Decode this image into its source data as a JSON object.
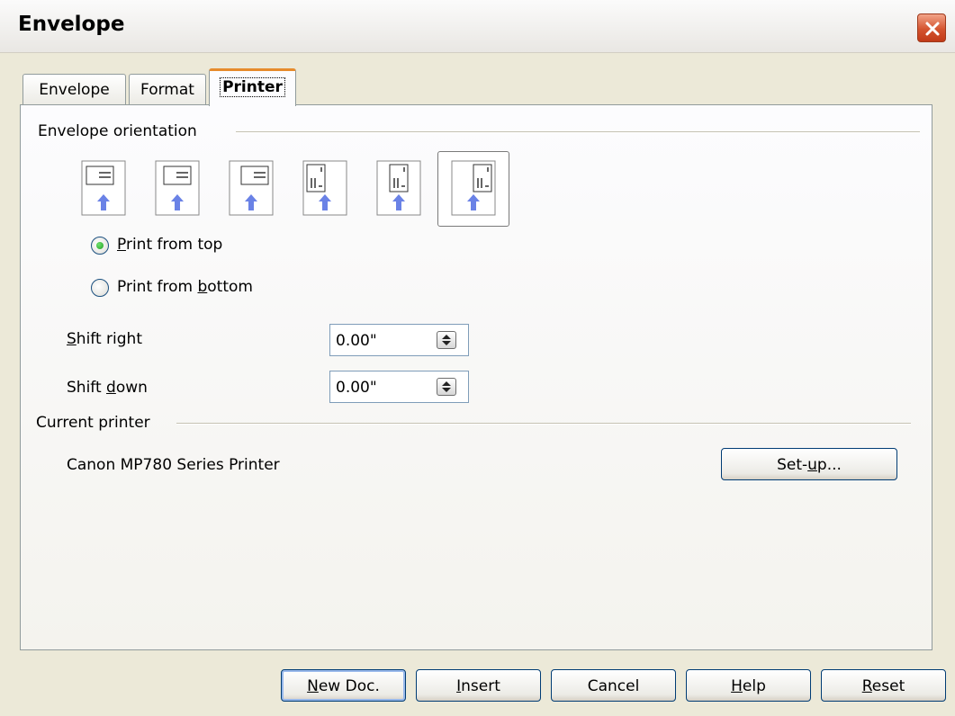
{
  "window": {
    "title": "Envelope",
    "close_icon": "close-icon",
    "accent_close": "#d4542f"
  },
  "tabs": [
    {
      "label": "Envelope",
      "active": false
    },
    {
      "label": "Format",
      "active": false
    },
    {
      "label": "Printer",
      "active": true
    }
  ],
  "orientation": {
    "label": "Envelope orientation",
    "options": [
      "orient-1",
      "orient-2",
      "orient-3",
      "orient-4",
      "orient-5",
      "orient-6"
    ],
    "selected_index": 5
  },
  "print_from": {
    "top": {
      "pre": "",
      "acc": "P",
      "post": "rint from top",
      "checked": true
    },
    "bottom": {
      "pre": "Print from ",
      "acc": "b",
      "post": "ottom",
      "checked": false
    }
  },
  "shift_right": {
    "pre": "",
    "acc": "S",
    "post": "hift right",
    "value": "0.00\""
  },
  "shift_down": {
    "pre": "Shift ",
    "acc": "d",
    "post": "own",
    "value": "0.00\""
  },
  "current_printer": {
    "label": "Current printer",
    "name": "Canon MP780 Series Printer",
    "setup": {
      "pre": "Set-",
      "acc": "u",
      "post": "p..."
    }
  },
  "buttons": {
    "new_doc": {
      "pre": "",
      "acc": "N",
      "post": "ew Doc."
    },
    "insert": {
      "pre": "",
      "acc": "I",
      "post": "nsert"
    },
    "cancel": {
      "pre": "Cancel",
      "acc": "",
      "post": ""
    },
    "help": {
      "pre": "",
      "acc": "H",
      "post": "elp"
    },
    "reset": {
      "pre": "",
      "acc": "R",
      "post": "eset"
    }
  },
  "colors": {
    "arrow": "#6a82e6",
    "tab_highlight": "#e68b2c",
    "radio_dot": "#21a121"
  }
}
